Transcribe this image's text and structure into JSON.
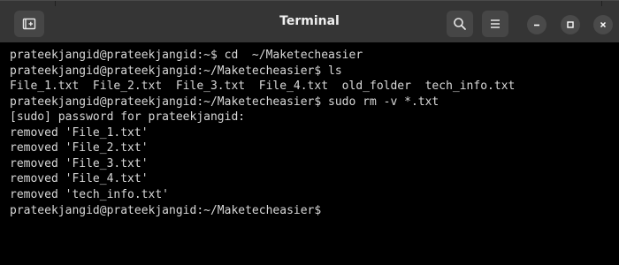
{
  "window": {
    "title": "Terminal"
  },
  "titlebar": {
    "new_tab_icon": "new-tab-icon",
    "search_icon": "search-icon",
    "menu_icon": "hamburger-menu-icon",
    "minimize_icon": "minimize-icon",
    "maximize_icon": "maximize-icon",
    "close_icon": "close-icon"
  },
  "colors": {
    "titlebar_bg": "#353535",
    "terminal_bg": "#000000",
    "terminal_fg": "#d8d8d8"
  },
  "terminal": {
    "lines": [
      "prateekjangid@prateekjangid:~$ cd  ~/Maketecheasier",
      "prateekjangid@prateekjangid:~/Maketecheasier$ ls",
      "File_1.txt  File_2.txt  File_3.txt  File_4.txt  old_folder  tech_info.txt",
      "prateekjangid@prateekjangid:~/Maketecheasier$ sudo rm -v *.txt",
      "[sudo] password for prateekjangid:",
      "removed 'File_1.txt'",
      "removed 'File_2.txt'",
      "removed 'File_3.txt'",
      "removed 'File_4.txt'",
      "removed 'tech_info.txt'",
      "prateekjangid@prateekjangid:~/Maketecheasier$"
    ]
  }
}
